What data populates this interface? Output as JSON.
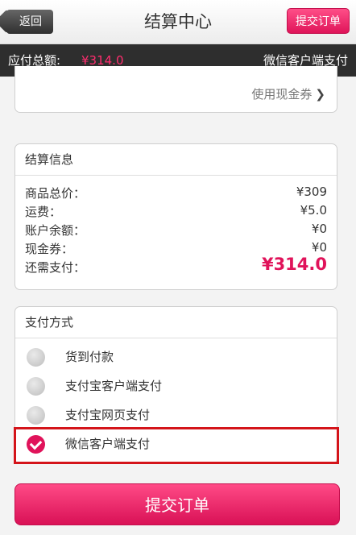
{
  "header": {
    "back_label": "返回",
    "title": "结算中心",
    "submit_label": "提交订单"
  },
  "summary": {
    "label": "应付总额:",
    "amount": "¥314.0",
    "method": "微信客户端支付"
  },
  "coupon": {
    "link_label": "使用现金券"
  },
  "settlement": {
    "heading": "结算信息",
    "rows": [
      {
        "label": "商品总价：",
        "value": "¥309"
      },
      {
        "label": "运费：",
        "value": "¥5.0"
      },
      {
        "label": "账户余额：",
        "value": "¥0"
      },
      {
        "label": "现金券：",
        "value": "¥0"
      },
      {
        "label": "还需支付：",
        "value": "¥314.0"
      }
    ]
  },
  "payment": {
    "heading": "支付方式",
    "options": [
      {
        "label": "货到付款",
        "selected": false
      },
      {
        "label": "支付宝客户端支付",
        "selected": false
      },
      {
        "label": "支付宝网页支付",
        "selected": false
      },
      {
        "label": "微信客户端支付",
        "selected": true
      }
    ]
  },
  "footer": {
    "submit_label": "提交订单"
  },
  "colors": {
    "accent": "#e0135a",
    "highlight_border": "#d4141a",
    "summary_bar": "#2e2e2e"
  }
}
